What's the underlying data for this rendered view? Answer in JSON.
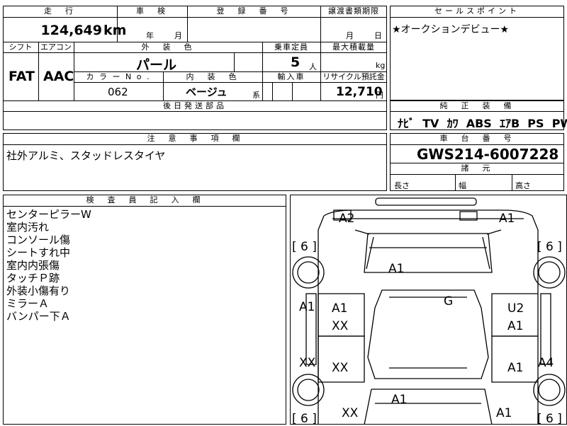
{
  "mileage": {
    "header": "走　行",
    "value": "124,649",
    "unit": "km"
  },
  "inspection": {
    "header": "車　検",
    "year_label": "年",
    "month_label": "月"
  },
  "registration": {
    "header": "登　録　番　号"
  },
  "transfer_deadline": {
    "header": "譲渡書類期限",
    "month_label": "月",
    "day_label": "日"
  },
  "sales_point": {
    "header": "セールスポイント",
    "text": "★オークションデビュー★"
  },
  "shift": {
    "header": "シフト",
    "value": "FAT"
  },
  "aircon": {
    "header": "エアコン",
    "value": "AAC"
  },
  "exterior_color": {
    "header": "外　装　色",
    "value": "パール"
  },
  "capacity": {
    "header": "乗車定員",
    "value": "5",
    "unit": "人"
  },
  "max_load": {
    "header": "最大積載量",
    "unit": "kg"
  },
  "color_no": {
    "header": "カ ラ ー N o .",
    "value": "062"
  },
  "interior_color": {
    "header": "内　装　色",
    "value": "ベージュ",
    "suffix": "系"
  },
  "import": {
    "header": "輸入車"
  },
  "recycle": {
    "header": "リサイクル預託金",
    "value": "12,710",
    "unit": "円"
  },
  "later_parts": {
    "header": "後日発送部品"
  },
  "equipment": {
    "header": "純　正　装　備",
    "items": "ﾅﾋﾞ  TV  ｶﾜ  ABS  ｴｱB  PS  PW"
  },
  "notes": {
    "header": "注　意　事　項　欄",
    "text": "社外アルミ、スタッドレスタイヤ"
  },
  "chassis": {
    "header": "車　台　番　号",
    "value": "GWS214-6007228"
  },
  "dimensions": {
    "header": "諸　元",
    "length_label": "長さ",
    "width_label": "幅",
    "height_label": "高さ"
  },
  "inspector": {
    "header": "検　査　員　記　入　欄",
    "lines": [
      "センターピラーW",
      "室内汚れ",
      "コンソール傷",
      "シートすれ中",
      "室内内張傷",
      "タッチＰ跡",
      "外装小傷有り",
      "ミラーＡ",
      "バンパー下Ａ"
    ]
  },
  "car_map": {
    "tire_front_left": "[ 6 ]",
    "tire_front_right": "[ 6 ]",
    "tire_rear_left": "[ 6 ]",
    "tire_rear_right": "[ 6 ]",
    "marks": {
      "front_left_corner": "A2",
      "front_right_corner": "A1",
      "hood": "A1",
      "roof": "G",
      "front_left_fender": "A1",
      "front_left_door_a": "A1",
      "front_left_door_b": "XX",
      "front_right_door_a": "U2",
      "front_right_door_b": "A1",
      "rear_left_quarter": "XX",
      "rear_left_door": "XX",
      "rear_right_door": "A1",
      "rear_right_quarter": "A4",
      "trunk": "A1",
      "rear_left_bumper": "XX",
      "rear_right_bumper": "A1"
    }
  }
}
